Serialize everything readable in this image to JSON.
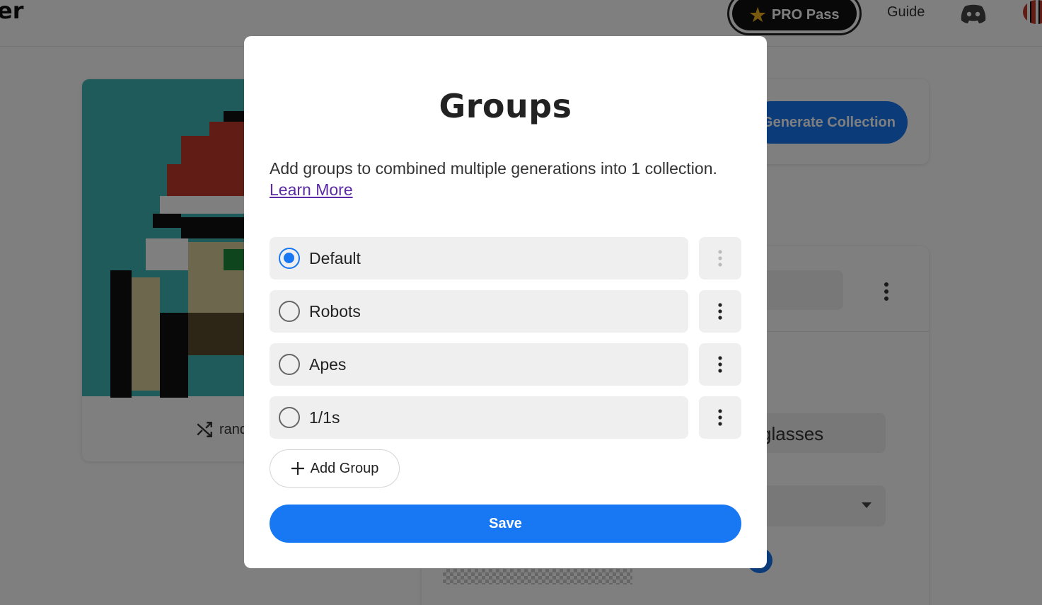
{
  "background": {
    "brand_fragment": "er",
    "pro_pass_label": "PRO Pass",
    "guide_label": "Guide",
    "generate_button_label": "Generate Collection",
    "random_label": "random",
    "trait_value": "glasses"
  },
  "modal": {
    "title": "Groups",
    "description": "Add groups to combined multiple generations into 1 collection.",
    "learn_more": "Learn More",
    "groups": [
      {
        "label": "Default",
        "selected": true
      },
      {
        "label": "Robots",
        "selected": false
      },
      {
        "label": "Apes",
        "selected": false
      },
      {
        "label": "1/1s",
        "selected": false
      }
    ],
    "add_group_label": "Add Group",
    "save_label": "Save"
  },
  "colors": {
    "primary": "#1877f2",
    "overlay": "rgba(0,0,0,0.5)",
    "pill_bg": "#efefef",
    "link": "#5b2aa6"
  }
}
